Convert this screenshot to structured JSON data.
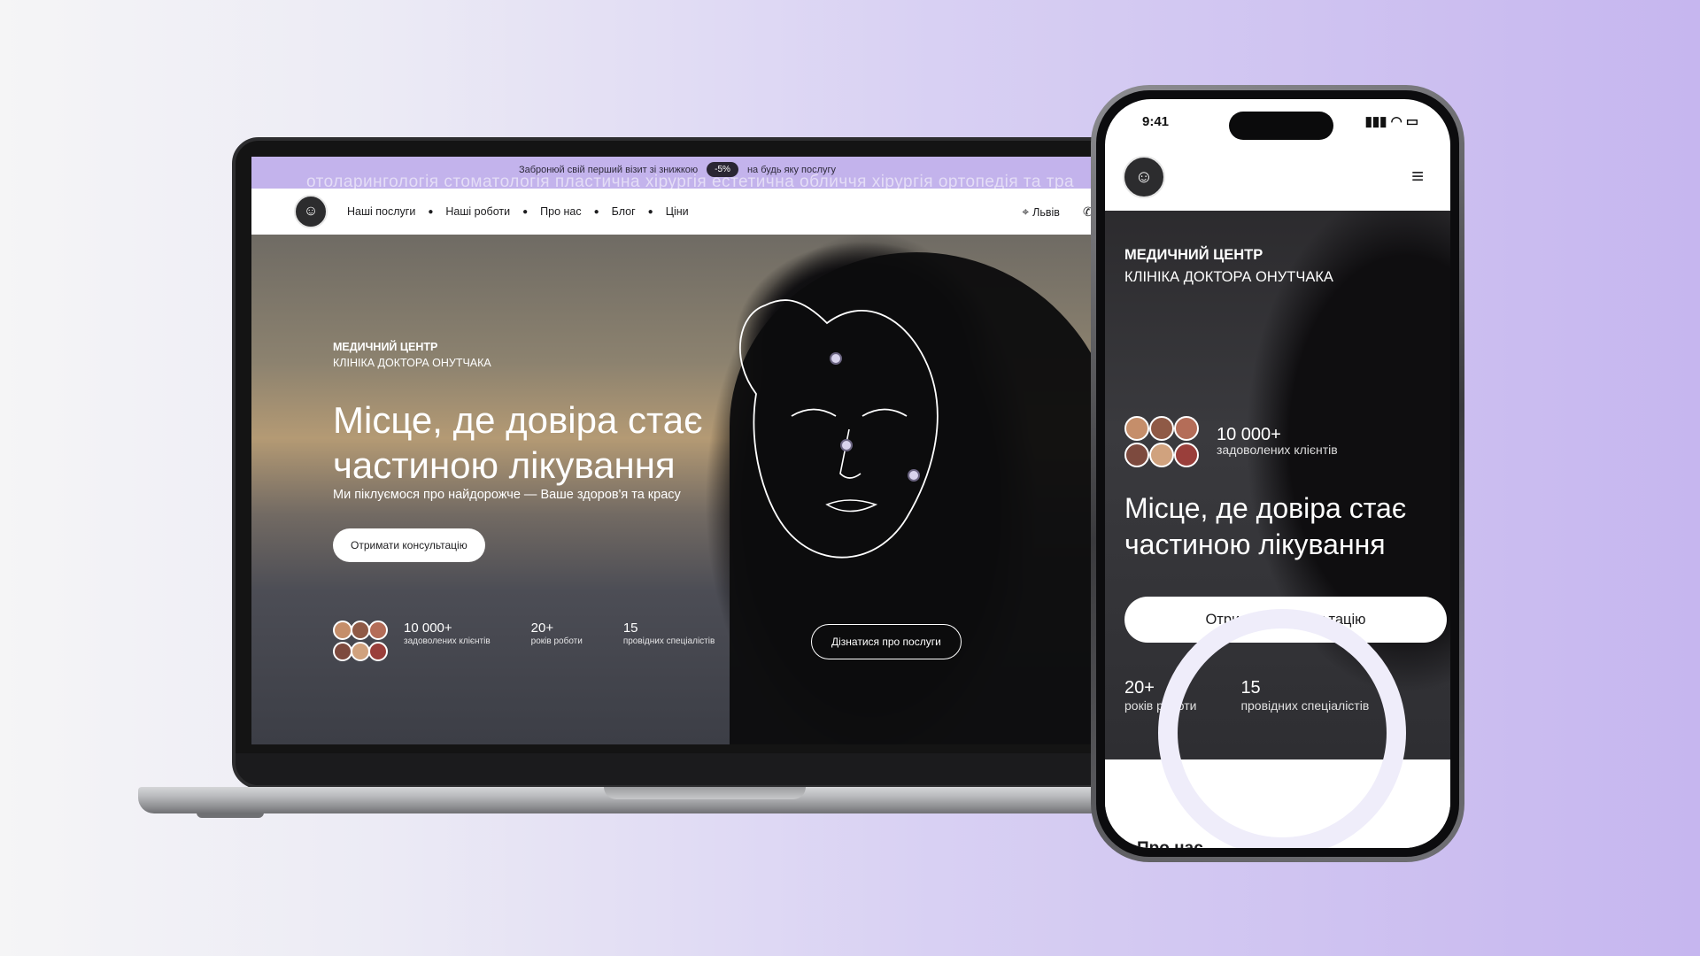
{
  "promo": {
    "ticker": "отоларингологія  стоматологія  пластична хірургія естетична обличчя  хірургія  ортопедія та тра",
    "text_before": "Забронюй свій перший візит зі знижкою",
    "badge": "-5%",
    "text_after": "на будь яку послугу"
  },
  "nav": {
    "items": [
      "Наші послуги",
      "Наші роботи",
      "Про нас",
      "Блог",
      "Ціни"
    ],
    "location": "Львів",
    "phone": "+"
  },
  "hero": {
    "kicker_line1": "МЕДИЧНИЙ ЦЕНТР",
    "kicker_line2": "КЛІНІКА ДОКТОРА ОНУТЧАКА",
    "title_line1": "Місце, де довіра стає",
    "title_line2": "частиною лікування",
    "subtitle": "Ми піклуємося про найдорожче — Ваше здоров'я та красу",
    "cta": "Отримати консультацію",
    "outline_cta": "Дізнатися про послуги",
    "stats": [
      {
        "value": "10 000+",
        "label": "задоволених клієнтів"
      },
      {
        "value": "20+",
        "label": "років роботи"
      },
      {
        "value": "15",
        "label": "провідних спеціалістів"
      }
    ]
  },
  "phone": {
    "time": "9:41",
    "kicker_line1": "МЕДИЧНИЙ ЦЕНТР",
    "kicker_line2": "КЛІНІКА ДОКТОРА ОНУТЧАКА",
    "clients_value": "10 000+",
    "clients_label": "задоволених клієнтів",
    "title_line1": "Місце, де довіра стає",
    "title_line2": "частиною лікування",
    "cta": "Отримати консультацію",
    "years_value": "20+",
    "years_label": "років роботи",
    "spec_value": "15",
    "spec_label": "провідних спеціалістів",
    "about": "Про нас"
  },
  "icons": {
    "logo": "logo-icon",
    "location": "map-pin-icon",
    "phone": "phone-icon",
    "menu": "hamburger-icon"
  },
  "colors": {
    "promo_bg": "#c3b3ec",
    "accent_lavender": "#c6b6ef",
    "dark": "#2a2633"
  }
}
